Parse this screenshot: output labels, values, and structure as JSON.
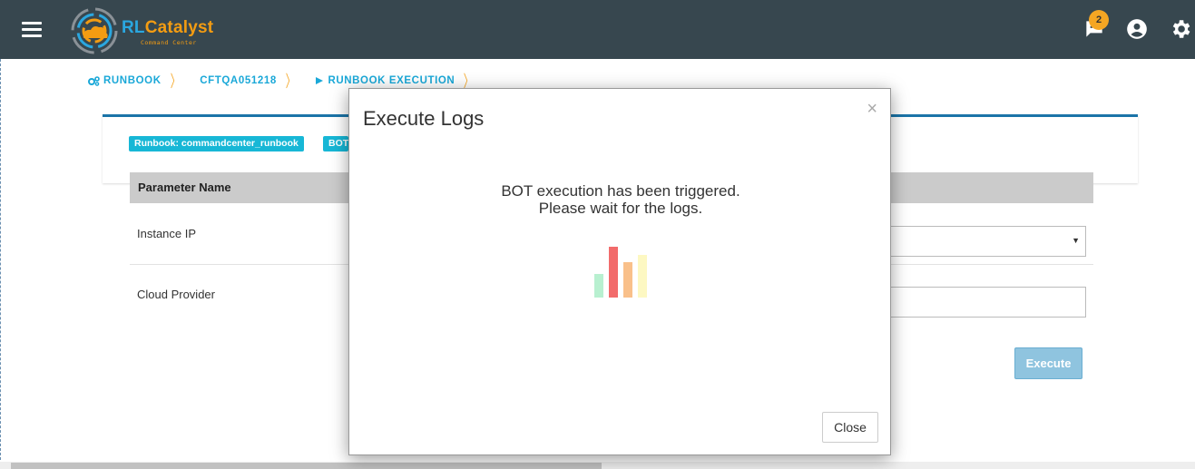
{
  "header": {
    "logo": {
      "brand_rl": "RL",
      "brand_catalyst": "Catalyst",
      "tagline": "Command Center"
    },
    "notification_count": "2",
    "icons": [
      "menu-icon",
      "chat-notification-icon",
      "account-icon",
      "gear-icon"
    ]
  },
  "breadcrumb": [
    {
      "label": "RUNBOOK",
      "icon": "cogs-icon"
    },
    {
      "label": "CFTQA051218"
    },
    {
      "label": "RUNBOOK EXECUTION",
      "icon": "play-icon"
    }
  ],
  "card": {
    "tags": [
      "Runbook: commandcenter_runbook",
      "BOT"
    ],
    "table": {
      "header": "Parameter Name",
      "rows": [
        "Instance IP",
        "Cloud Provider"
      ]
    },
    "execute_label": "Execute"
  },
  "modal": {
    "title": "Execute Logs",
    "close_symbol": "×",
    "message_line1": "BOT execution has been triggered.",
    "message_line2": "Please wait for the logs.",
    "close_label": "Close"
  },
  "colors": {
    "navbar": "#37474f",
    "accent": "#1aa8d8",
    "breadcrumb_separator": "#f5a623",
    "tag": "#17b7d6",
    "loader_bars": [
      "#b8f0d0",
      "#f26b6b",
      "#f9c08a",
      "#fdf8c2"
    ]
  }
}
